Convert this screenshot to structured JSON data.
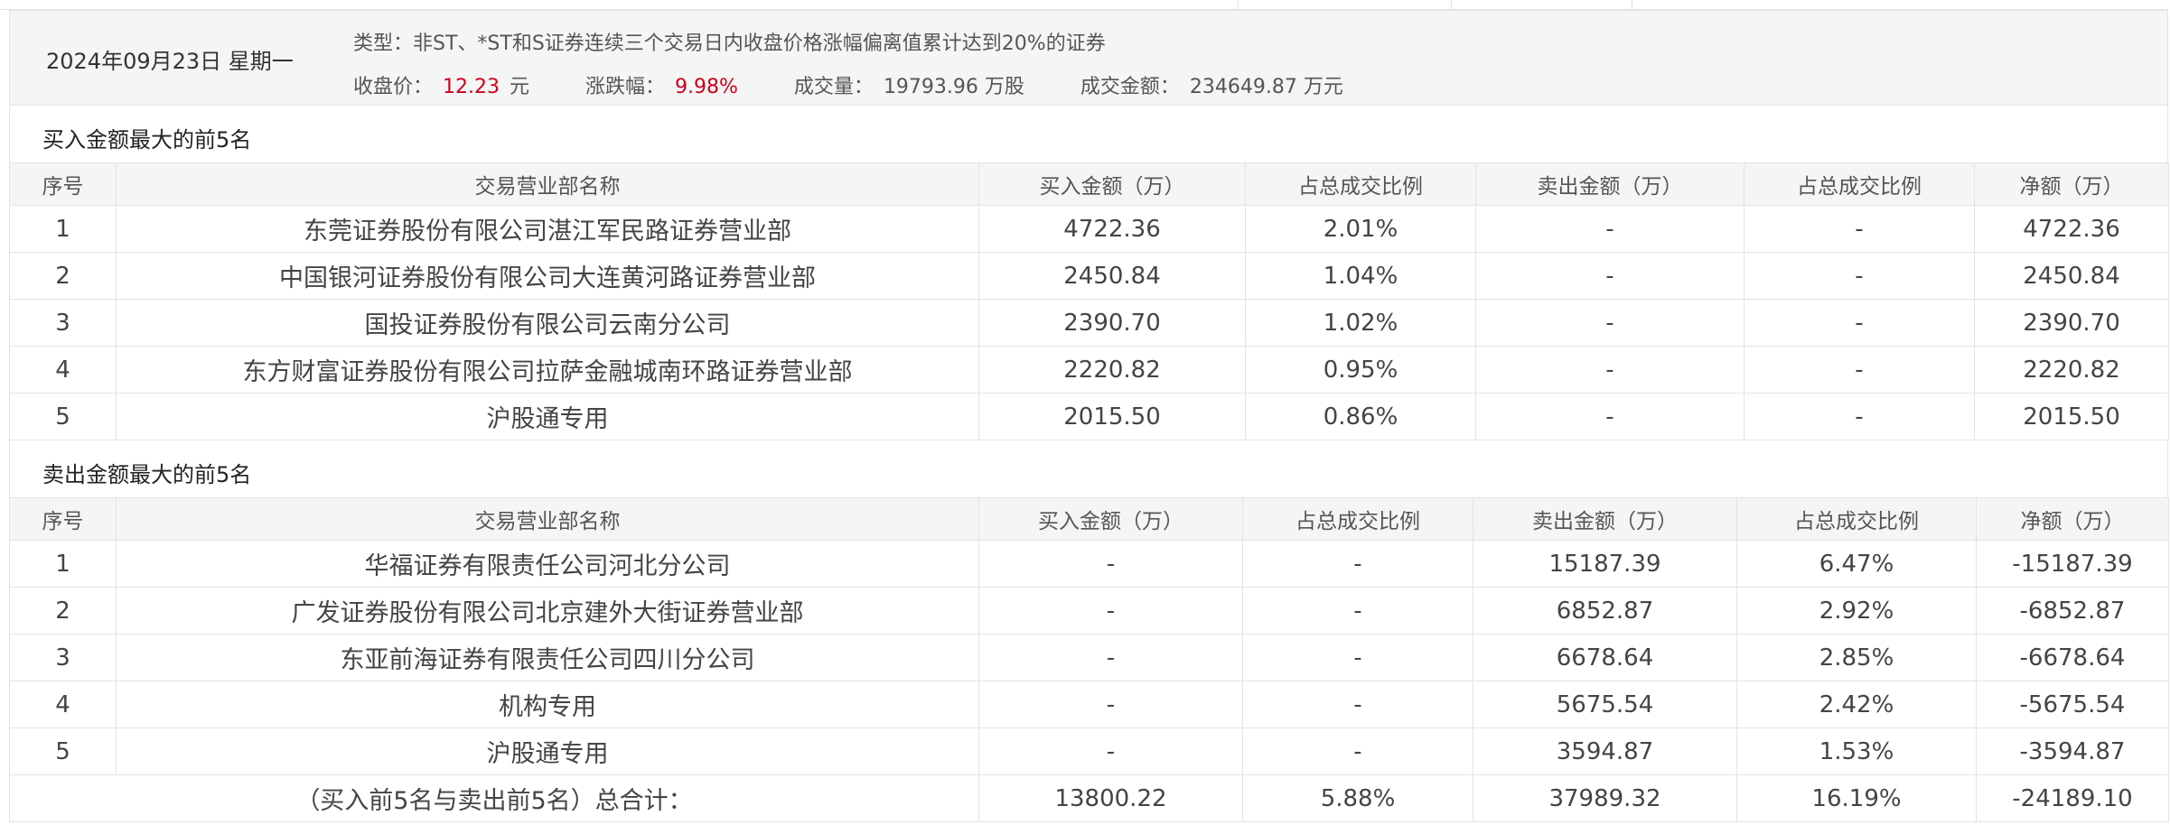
{
  "info": {
    "date": "2024年09月23日 星期一",
    "type_label": "类型：",
    "type_value": "非ST、*ST和S证券连续三个交易日内收盘价格涨幅偏离值累计达到20%的证券",
    "close_label": "收盘价：",
    "close_value": "12.23",
    "close_unit": "元",
    "change_label": "涨跌幅：",
    "change_value": "9.98%",
    "volume_label": "成交量：",
    "volume_value": "19793.96 万股",
    "amount_label": "成交金额：",
    "amount_value": "234649.87 万元"
  },
  "buy_section": {
    "title": "买入金额最大的前5名",
    "headers": [
      "序号",
      "交易营业部名称",
      "买入金额（万）",
      "占总成交比例",
      "卖出金额（万）",
      "占总成交比例",
      "净额（万）"
    ],
    "rows": [
      {
        "idx": "1",
        "name": "东莞证券股份有限公司湛江军民路证券营业部",
        "buy": "4722.36",
        "buy_pct": "2.01%",
        "sell": "-",
        "sell_pct": "-",
        "net": "4722.36"
      },
      {
        "idx": "2",
        "name": "中国银河证券股份有限公司大连黄河路证券营业部",
        "buy": "2450.84",
        "buy_pct": "1.04%",
        "sell": "-",
        "sell_pct": "-",
        "net": "2450.84"
      },
      {
        "idx": "3",
        "name": "国投证券股份有限公司云南分公司",
        "buy": "2390.70",
        "buy_pct": "1.02%",
        "sell": "-",
        "sell_pct": "-",
        "net": "2390.70"
      },
      {
        "idx": "4",
        "name": "东方财富证券股份有限公司拉萨金融城南环路证券营业部",
        "buy": "2220.82",
        "buy_pct": "0.95%",
        "sell": "-",
        "sell_pct": "-",
        "net": "2220.82"
      },
      {
        "idx": "5",
        "name": "沪股通专用",
        "buy": "2015.50",
        "buy_pct": "0.86%",
        "sell": "-",
        "sell_pct": "-",
        "net": "2015.50"
      }
    ]
  },
  "sell_section": {
    "title": "卖出金额最大的前5名",
    "headers": [
      "序号",
      "交易营业部名称",
      "买入金额（万）",
      "占总成交比例",
      "卖出金额（万）",
      "占总成交比例",
      "净额（万）"
    ],
    "rows": [
      {
        "idx": "1",
        "name": "华福证券有限责任公司河北分公司",
        "buy": "-",
        "buy_pct": "-",
        "sell": "15187.39",
        "sell_pct": "6.47%",
        "net": "-15187.39"
      },
      {
        "idx": "2",
        "name": "广发证券股份有限公司北京建外大街证券营业部",
        "buy": "-",
        "buy_pct": "-",
        "sell": "6852.87",
        "sell_pct": "2.92%",
        "net": "-6852.87"
      },
      {
        "idx": "3",
        "name": "东亚前海证券有限责任公司四川分公司",
        "buy": "-",
        "buy_pct": "-",
        "sell": "6678.64",
        "sell_pct": "2.85%",
        "net": "-6678.64"
      },
      {
        "idx": "4",
        "name": "机构专用",
        "buy": "-",
        "buy_pct": "-",
        "sell": "5675.54",
        "sell_pct": "2.42%",
        "net": "-5675.54"
      },
      {
        "idx": "5",
        "name": "沪股通专用",
        "buy": "-",
        "buy_pct": "-",
        "sell": "3594.87",
        "sell_pct": "1.53%",
        "net": "-3594.87"
      }
    ],
    "total": {
      "label": "（买入前5名与卖出前5名）总合计：",
      "buy": "13800.22",
      "buy_pct": "5.88%",
      "sell": "37989.32",
      "sell_pct": "16.19%",
      "net": "-24189.10"
    }
  },
  "colors": {
    "buy_red": "#d0021b",
    "sell_green": "#2e8b00",
    "header_bg": "#f5f5f5",
    "border": "#e3e3e3"
  }
}
